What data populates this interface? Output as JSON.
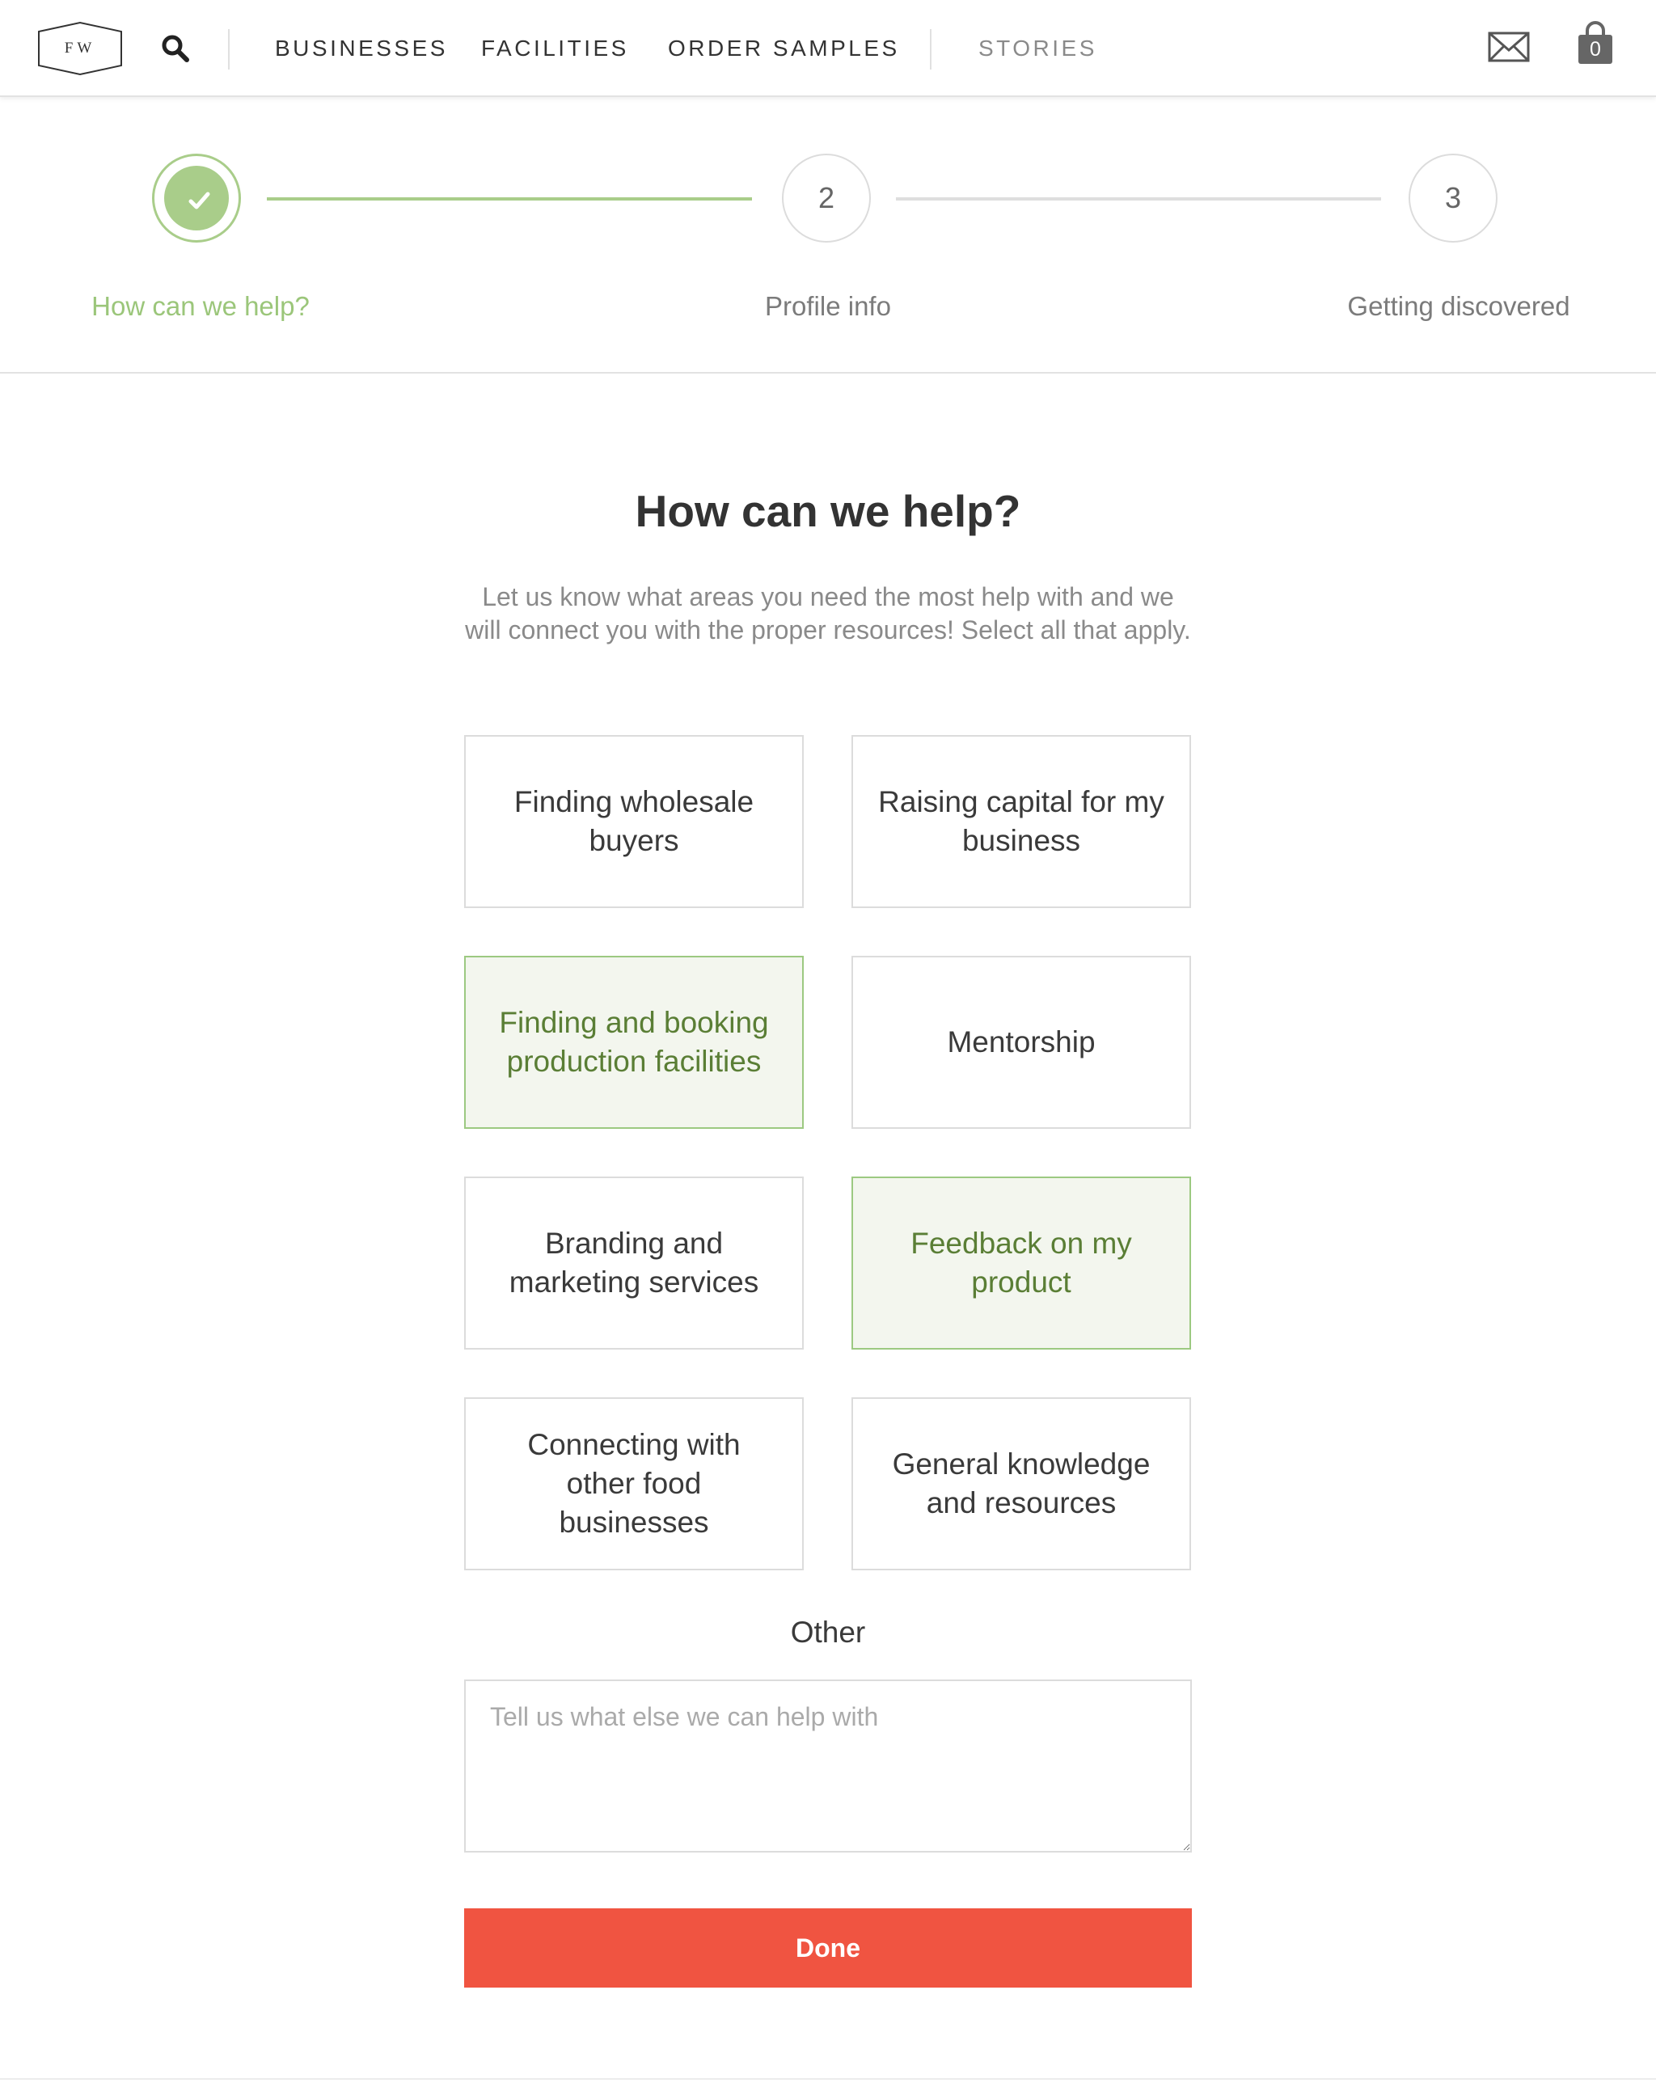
{
  "header": {
    "logo_text": "FW",
    "nav": {
      "businesses": "BUSINESSES",
      "facilities": "FACILITIES",
      "order_samples": "ORDER SAMPLES",
      "stories": "STORIES"
    },
    "icons": {
      "search": "search-icon",
      "mail": "mail-icon",
      "cart": "shopping-bag-icon"
    },
    "cart_count": "0"
  },
  "steps": [
    {
      "number": "✓",
      "label": "How can we help?",
      "status": "complete"
    },
    {
      "number": "2",
      "label": "Profile info",
      "status": "pending"
    },
    {
      "number": "3",
      "label": "Getting discovered",
      "status": "pending"
    }
  ],
  "main": {
    "title": "How can we help?",
    "description": "Let us know what areas you need the most help with and we will connect you with the proper resources! Select all that apply.",
    "options": [
      {
        "label": "Finding wholesale buyers",
        "selected": false
      },
      {
        "label": "Raising capital for my business",
        "selected": false
      },
      {
        "label": "Finding and booking production facilities",
        "selected": true
      },
      {
        "label": "Mentorship",
        "selected": false
      },
      {
        "label": "Branding and marketing services",
        "selected": false
      },
      {
        "label": "Feedback on my product",
        "selected": true
      },
      {
        "label": "Connecting with other food businesses",
        "selected": false
      },
      {
        "label": "General knowledge and resources",
        "selected": false
      }
    ],
    "other_label": "Other",
    "other_placeholder": "Tell us what else we can help with",
    "other_value": "",
    "done_label": "Done"
  },
  "colors": {
    "accent_green": "#a9cd8a",
    "selected_bg": "#f3f6ee",
    "done_button": "#f05441"
  }
}
